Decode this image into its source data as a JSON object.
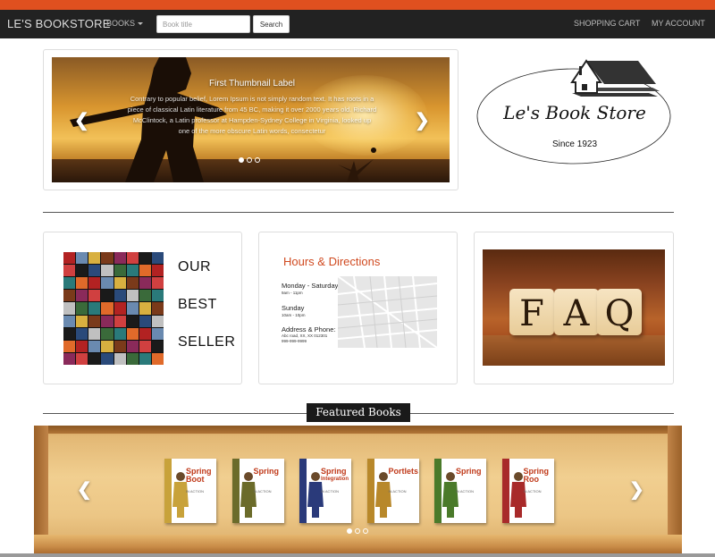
{
  "navbar": {
    "brand": "LE'S BOOKSTORE",
    "books_menu": "BOOKS",
    "search_placeholder": "Book title",
    "search_button": "Search",
    "cart": "SHOPPING CART",
    "account": "MY ACCOUNT"
  },
  "hero": {
    "title": "First Thumbnail Label",
    "text": "Contrary to popular belief, Lorem Ipsum is not simply random text. It has roots in a piece of classical Latin literature from 45 BC, making it over 2000 years old. Richard McClintock, a Latin professor at Hampden-Sydney College in Virginia, looked up one of the more obscure Latin words, consectetur",
    "prev_icon": "chevron-left-icon",
    "next_icon": "chevron-right-icon",
    "indicator_count": 3,
    "active_indicator": 1
  },
  "logo": {
    "name": "Le's Book Store",
    "since": "Since 1923"
  },
  "cards": {
    "best_seller": {
      "line1": "OUR",
      "line2": "BEST",
      "line3": "SELLER"
    },
    "hours": {
      "title": "Hours & Directions",
      "days_label": "Monday - Saturday",
      "days_hours": "9am - 11pm",
      "sunday_label": "Sunday",
      "sunday_hours": "10am - 10pm",
      "address_label": "Address & Phone:",
      "address_line": "Abc road, XX, XX 012301",
      "phone": "999-999-9999"
    },
    "faq": {
      "letters": [
        "F",
        "A",
        "Q"
      ]
    }
  },
  "featured": {
    "heading": "Featured Books",
    "books": [
      {
        "title_line1": "Spring",
        "title_line2": "Boot",
        "subtitle": "IN ACTION",
        "stripe": "#c8a23a"
      },
      {
        "title_line1": "Spring",
        "title_line2": "",
        "subtitle": "IN ACTION",
        "stripe": "#6b6b2a"
      },
      {
        "title_line1": "Spring",
        "title_line2": "Integration",
        "subtitle": "IN ACTION",
        "stripe": "#2a3a7a"
      },
      {
        "title_line1": "Portlets",
        "title_line2": "",
        "subtitle": "IN ACTION",
        "stripe": "#b8882a"
      },
      {
        "title_line1": "Spring",
        "title_line2": "",
        "subtitle": "IN ACTION",
        "stripe": "#4a7a2a"
      },
      {
        "title_line1": "Spring",
        "title_line2": "Roo",
        "subtitle": "IN ACTION",
        "stripe": "#a82a2a"
      }
    ],
    "prev_icon": "chevron-left-icon",
    "next_icon": "chevron-right-icon",
    "indicator_count": 3,
    "active_indicator": 1
  },
  "colors": {
    "accent": "#e0501f",
    "navbar": "#222222",
    "hours_title": "#d04a20"
  }
}
